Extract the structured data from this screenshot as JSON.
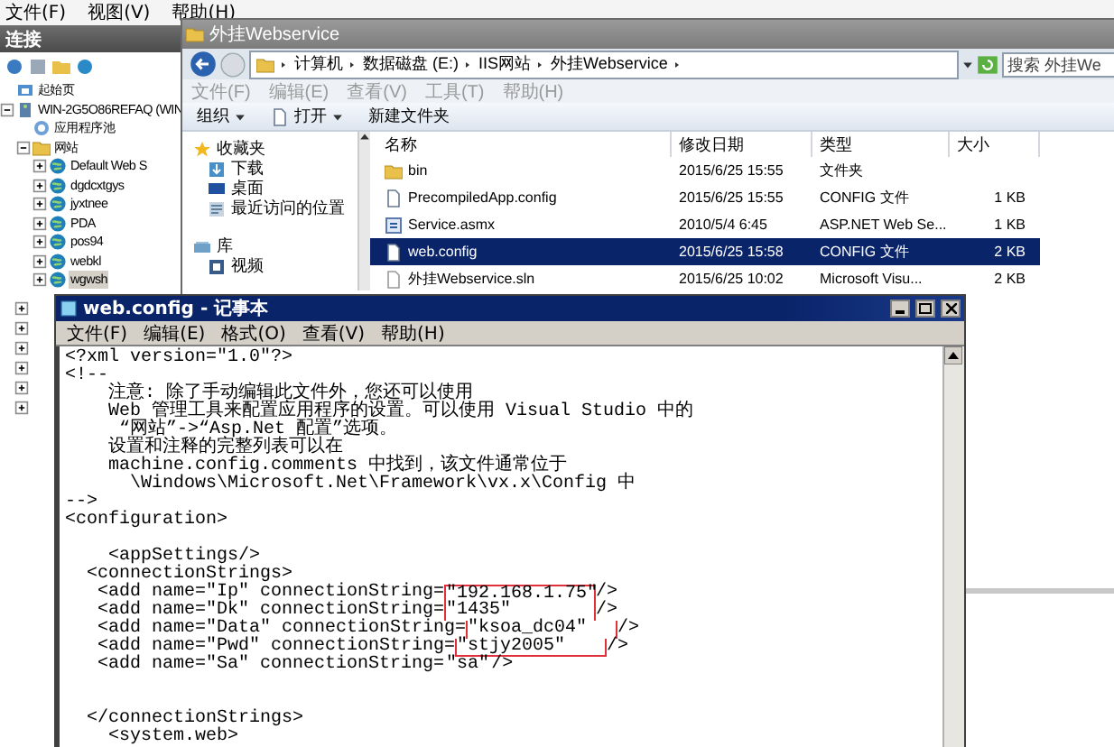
{
  "iis_manager": {
    "menu": [
      "文件(F)",
      "视图(V)",
      "帮助(H)"
    ],
    "connections_title": "连接",
    "tree": [
      {
        "label": "起始页",
        "kind": "start",
        "selected": false
      },
      {
        "label": "WIN-2G5O86REFAQ (WIN",
        "kind": "server",
        "selected": false,
        "expanded": true,
        "children": [
          {
            "label": "应用程序池",
            "kind": "pool",
            "selected": false
          },
          {
            "label": "网站",
            "kind": "sites",
            "selected": false,
            "expanded": true,
            "children": [
              {
                "label": "Default Web S",
                "kind": "site",
                "selected": false,
                "expanded": false
              },
              {
                "label": "dgdcxtgys",
                "kind": "site",
                "selected": false,
                "expanded": false
              },
              {
                "label": "jyxtnee",
                "kind": "site",
                "selected": false,
                "expanded": false
              },
              {
                "label": "PDA",
                "kind": "site",
                "selected": false,
                "expanded": false
              },
              {
                "label": "pos94",
                "kind": "site",
                "selected": false,
                "expanded": false
              },
              {
                "label": "webkl",
                "kind": "site",
                "selected": false,
                "expanded": false
              },
              {
                "label": "wgwsh",
                "kind": "site",
                "selected": true,
                "expanded": false
              }
            ]
          }
        ]
      }
    ]
  },
  "explorer": {
    "title": "外挂Webservice",
    "breadcrumb": [
      "计算机",
      "数据磁盘 (E:)",
      "IIS网站",
      "外挂Webservice"
    ],
    "search": {
      "placeholder": "搜索 外挂We"
    },
    "menu": [
      "文件(F)",
      "编辑(E)",
      "查看(V)",
      "工具(T)",
      "帮助(H)"
    ],
    "toolbar": [
      {
        "label": "组织",
        "kind": "menu"
      },
      {
        "label": "打开",
        "kind": "open"
      },
      {
        "label": "新建文件夹",
        "kind": "plain"
      }
    ],
    "nav": [
      {
        "label": "收藏夹",
        "kind": "favorites",
        "children": [
          {
            "label": "下载",
            "kind": "downloads"
          },
          {
            "label": "桌面",
            "kind": "desktop"
          },
          {
            "label": "最近访问的位置",
            "kind": "recent"
          }
        ]
      },
      {
        "label": "库",
        "kind": "library",
        "children": [
          {
            "label": "视频",
            "kind": "videos"
          }
        ]
      }
    ],
    "columns": [
      "名称",
      "修改日期",
      "类型",
      "大小"
    ],
    "rows": [
      {
        "name": "bin",
        "modified": "2015/6/25 15:55",
        "type": "文件夹",
        "kind": "folder",
        "selected": false
      },
      {
        "name": "PrecompiledApp.config",
        "modified": "2015/6/25 15:55",
        "type": "CONFIG 文件",
        "size": "1 KB",
        "kind": "config",
        "selected": false
      },
      {
        "name": "Service.asmx",
        "modified": "2010/5/4 6:45",
        "type": "ASP.NET Web Se...",
        "size": "1 KB",
        "kind": "asmx",
        "selected": false
      },
      {
        "name": "web.config",
        "modified": "2015/6/25 15:58",
        "type": "CONFIG 文件",
        "size": "2 KB",
        "kind": "config",
        "selected": true
      },
      {
        "name": "外挂Webservice.sln",
        "modified": "2015/6/25 10:02",
        "type": "Microsoft Visu...",
        "size": "2 KB",
        "kind": "sln",
        "selected": false
      }
    ]
  },
  "notepad": {
    "title": "web.config - 记事本",
    "menu": [
      "文件(F)",
      "编辑(E)",
      "格式(O)",
      "查看(V)",
      "帮助(H)"
    ],
    "lines": [
      {
        "kind": "code",
        "text": "<?xml version=\"1.0\"?>"
      },
      {
        "kind": "code",
        "text": "<!--"
      },
      {
        "kind": "code",
        "text": "    注意: 除了手动编辑此文件外，您还可以使用"
      },
      {
        "kind": "code",
        "text": "    Web 管理工具来配置应用程序的设置。可以使用 Visual Studio 中的"
      },
      {
        "kind": "code",
        "text": "     “网站”->“Asp.Net 配置”选项。"
      },
      {
        "kind": "code",
        "text": "    设置和注释的完整列表可以在"
      },
      {
        "kind": "code",
        "text": "    machine.config.comments 中找到，该文件通常位于"
      },
      {
        "kind": "code",
        "text": "      \\Windows\\Microsoft.Net\\Framework\\vx.x\\Config 中"
      },
      {
        "kind": "code",
        "text": "-->"
      },
      {
        "kind": "code",
        "text": "<configuration>"
      },
      {
        "kind": "blank"
      },
      {
        "kind": "code",
        "text": "    <appSettings/>"
      },
      {
        "kind": "code",
        "text": "  <connectionStrings>"
      },
      {
        "kind": "setting",
        "text": "   <add name=\"Ip\" connectionString=",
        "value": "\"192.168.1.75\"",
        "end": "/>",
        "boxed": true
      },
      {
        "kind": "setting",
        "text": "   <add name=\"Dk\" connectionString=",
        "value": "\"1435\"",
        "end": "/>",
        "boxed": true
      },
      {
        "kind": "setting",
        "text": "   <add name=\"Data\" connectionString=",
        "value": "\"ksoa_dc04\"",
        "end": "/>",
        "boxed": true
      },
      {
        "kind": "setting",
        "text": "   <add name=\"Pwd\" connectionString=",
        "value": "\"stjy2005\"",
        "end": "/>",
        "boxed": true
      },
      {
        "kind": "setting",
        "text": "   <add name=\"Sa\" connectionString=",
        "value": "\"sa\"",
        "end": "/>",
        "boxed": false
      },
      {
        "kind": "blank"
      },
      {
        "kind": "blank"
      },
      {
        "kind": "code",
        "text": "  </connectionStrings>"
      },
      {
        "kind": "code",
        "text": "    <system.web>"
      }
    ]
  }
}
